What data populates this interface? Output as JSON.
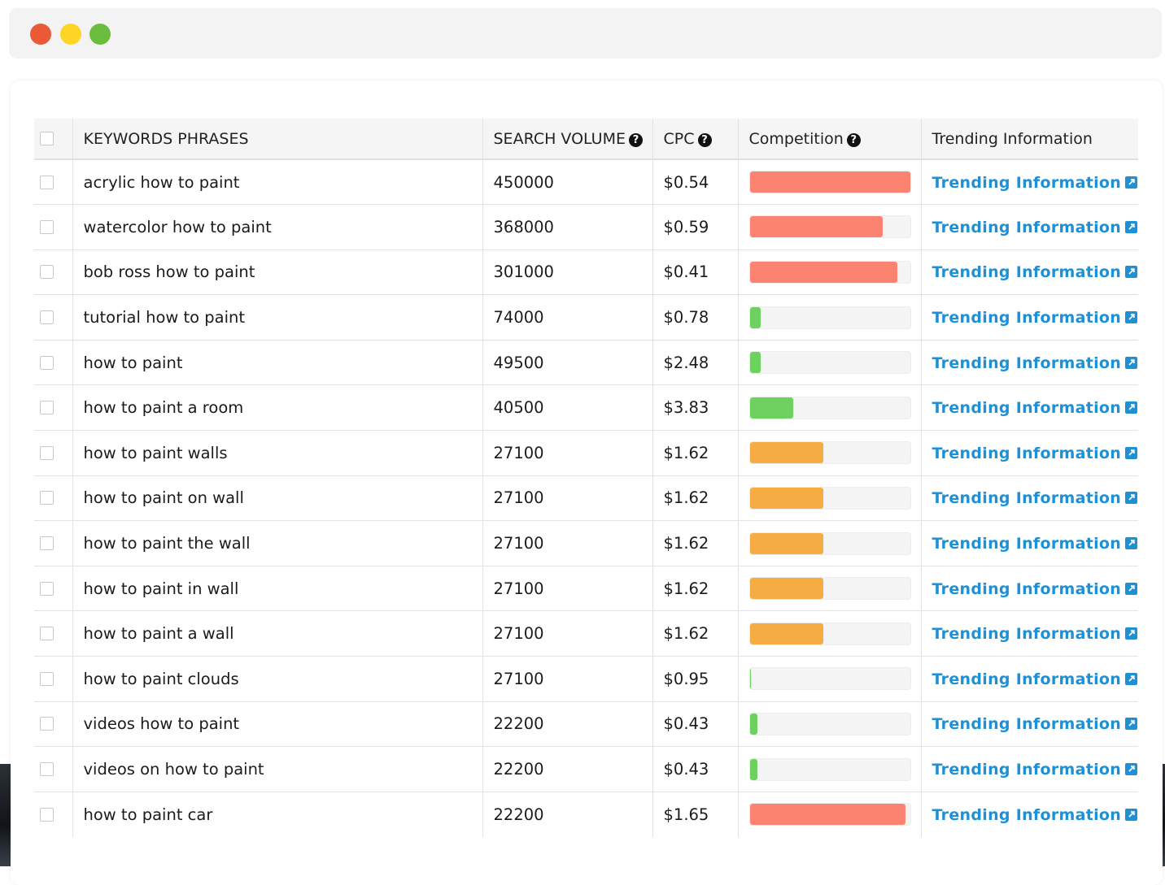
{
  "window": {
    "colors": {
      "close": "#eb5a36",
      "minimize": "#fdd525",
      "maximize": "#6bbd3e"
    }
  },
  "table": {
    "headers": {
      "keywords": "KEYWORDS PHRASES",
      "search_volume": "SEARCH VOLUME",
      "cpc": "CPC",
      "competition": "Competition",
      "trending": "Trending Information"
    },
    "help_icon": "question-circle-icon",
    "link_icon": "external-link-icon",
    "competition_colors": {
      "high": "#fb8370",
      "medium": "#f5ac42",
      "low": "#6dd15f"
    },
    "rows": [
      {
        "keyword": "acrylic how to paint",
        "volume": "450000",
        "cpc": "$0.54",
        "competition": 1.0,
        "level": "high",
        "trend": "Trending Information"
      },
      {
        "keyword": "watercolor how to paint",
        "volume": "368000",
        "cpc": "$0.59",
        "competition": 0.83,
        "level": "high",
        "trend": "Trending Information"
      },
      {
        "keyword": "bob ross how to paint",
        "volume": "301000",
        "cpc": "$0.41",
        "competition": 0.92,
        "level": "high",
        "trend": "Trending Information"
      },
      {
        "keyword": "tutorial how to paint",
        "volume": "74000",
        "cpc": "$0.78",
        "competition": 0.07,
        "level": "low",
        "trend": "Trending Information"
      },
      {
        "keyword": "how to paint",
        "volume": "49500",
        "cpc": "$2.48",
        "competition": 0.07,
        "level": "low",
        "trend": "Trending Information"
      },
      {
        "keyword": "how to paint a room",
        "volume": "40500",
        "cpc": "$3.83",
        "competition": 0.27,
        "level": "low",
        "trend": "Trending Information"
      },
      {
        "keyword": "how to paint walls",
        "volume": "27100",
        "cpc": "$1.62",
        "competition": 0.46,
        "level": "medium",
        "trend": "Trending Information"
      },
      {
        "keyword": "how to paint on wall",
        "volume": "27100",
        "cpc": "$1.62",
        "competition": 0.46,
        "level": "medium",
        "trend": "Trending Information"
      },
      {
        "keyword": "how to paint the wall",
        "volume": "27100",
        "cpc": "$1.62",
        "competition": 0.46,
        "level": "medium",
        "trend": "Trending Information"
      },
      {
        "keyword": "how to paint in wall",
        "volume": "27100",
        "cpc": "$1.62",
        "competition": 0.46,
        "level": "medium",
        "trend": "Trending Information"
      },
      {
        "keyword": "how to paint a wall",
        "volume": "27100",
        "cpc": "$1.62",
        "competition": 0.46,
        "level": "medium",
        "trend": "Trending Information"
      },
      {
        "keyword": "how to paint clouds",
        "volume": "27100",
        "cpc": "$0.95",
        "competition": 0.01,
        "level": "low",
        "trend": "Trending Information"
      },
      {
        "keyword": "videos how to paint",
        "volume": "22200",
        "cpc": "$0.43",
        "competition": 0.05,
        "level": "low",
        "trend": "Trending Information"
      },
      {
        "keyword": "videos on how to paint",
        "volume": "22200",
        "cpc": "$0.43",
        "competition": 0.05,
        "level": "low",
        "trend": "Trending Information"
      },
      {
        "keyword": "how to paint car",
        "volume": "22200",
        "cpc": "$1.65",
        "competition": 0.97,
        "level": "high",
        "trend": "Trending Information"
      }
    ]
  }
}
